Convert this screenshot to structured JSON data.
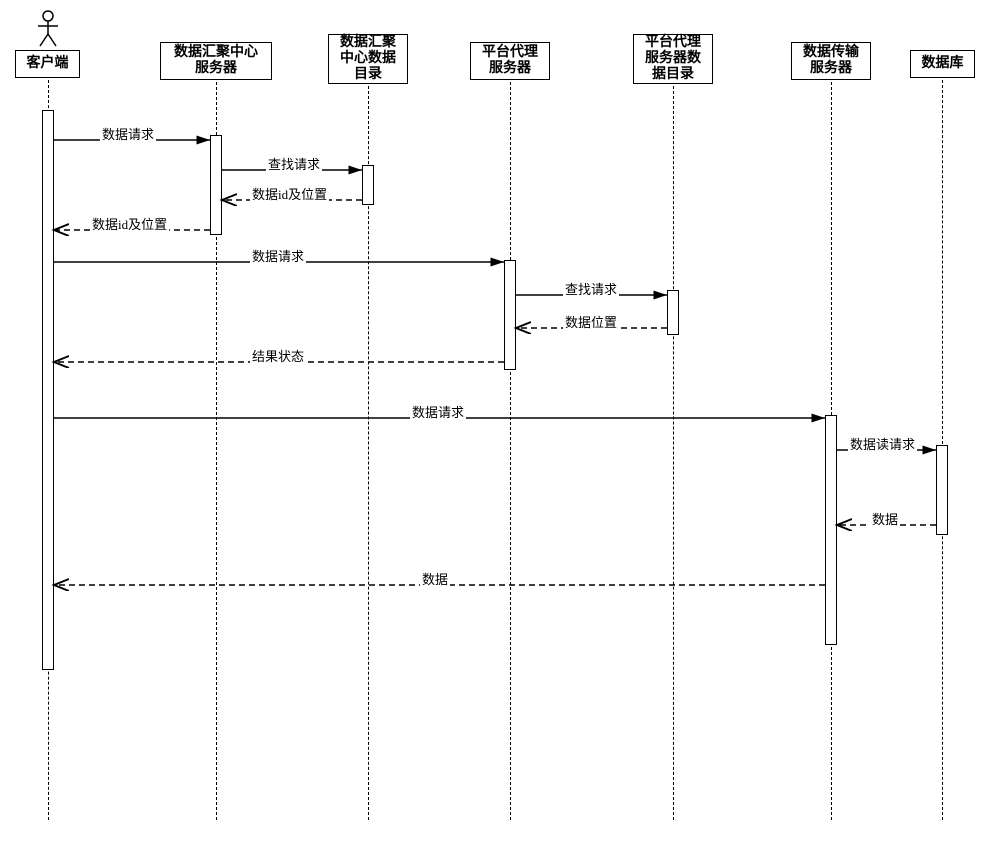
{
  "participants": {
    "client": "客户端",
    "aggServer": "数据汇聚中心\n服务器",
    "aggDir": "数据汇聚\n中心数据\n目录",
    "platformProxy": "平台代理\n服务器",
    "platformProxyDir": "平台代理\n服务器数\n据目录",
    "transferServer": "数据传输\n服务器",
    "database": "数据库"
  },
  "messages": {
    "m1": "数据请求",
    "m2": "查找请求",
    "m3": "数据id及位置",
    "m4": "数据id及位置",
    "m5": "数据请求",
    "m6": "查找请求",
    "m7": "数据位置",
    "m8": "结果状态",
    "m9": "数据请求",
    "m10": "数据读请求",
    "m11": "数据",
    "m12": "数据"
  },
  "chart_data": {
    "type": "sequence_diagram",
    "actor": "客户端",
    "participants": [
      {
        "name": "客户端",
        "type": "actor"
      },
      {
        "name": "数据汇聚中心服务器",
        "type": "object"
      },
      {
        "name": "数据汇聚中心数据目录",
        "type": "object"
      },
      {
        "name": "平台代理服务器",
        "type": "object"
      },
      {
        "name": "平台代理服务器数据目录",
        "type": "object"
      },
      {
        "name": "数据传输服务器",
        "type": "object"
      },
      {
        "name": "数据库",
        "type": "object"
      }
    ],
    "messages": [
      {
        "from": "客户端",
        "to": "数据汇聚中心服务器",
        "label": "数据请求",
        "type": "sync"
      },
      {
        "from": "数据汇聚中心服务器",
        "to": "数据汇聚中心数据目录",
        "label": "查找请求",
        "type": "sync"
      },
      {
        "from": "数据汇聚中心数据目录",
        "to": "数据汇聚中心服务器",
        "label": "数据id及位置",
        "type": "return"
      },
      {
        "from": "数据汇聚中心服务器",
        "to": "客户端",
        "label": "数据id及位置",
        "type": "return"
      },
      {
        "from": "客户端",
        "to": "平台代理服务器",
        "label": "数据请求",
        "type": "sync"
      },
      {
        "from": "平台代理服务器",
        "to": "平台代理服务器数据目录",
        "label": "查找请求",
        "type": "sync"
      },
      {
        "from": "平台代理服务器数据目录",
        "to": "平台代理服务器",
        "label": "数据位置",
        "type": "return"
      },
      {
        "from": "平台代理服务器",
        "to": "客户端",
        "label": "结果状态",
        "type": "return"
      },
      {
        "from": "客户端",
        "to": "数据传输服务器",
        "label": "数据请求",
        "type": "sync"
      },
      {
        "from": "数据传输服务器",
        "to": "数据库",
        "label": "数据读请求",
        "type": "sync"
      },
      {
        "from": "数据库",
        "to": "数据传输服务器",
        "label": "数据",
        "type": "return"
      },
      {
        "from": "数据传输服务器",
        "to": "客户端",
        "label": "数据",
        "type": "return"
      }
    ]
  }
}
